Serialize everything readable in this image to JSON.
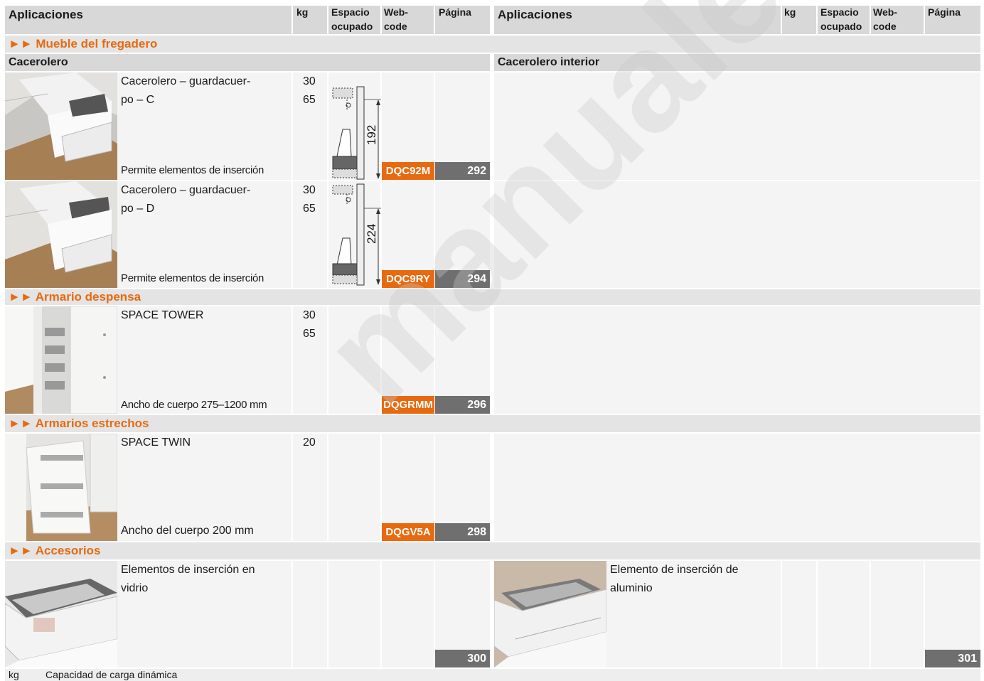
{
  "header": {
    "left": {
      "aplicaciones": "Aplicaciones",
      "kg": "kg",
      "espacio1": "Espacio",
      "espacio2": "ocupado",
      "web1": "Web-",
      "web2": "code",
      "pagina": "Página"
    },
    "right": {
      "aplicaciones": "Aplicaciones",
      "kg": "kg",
      "espacio1": "Espacio",
      "espacio2": "ocupado",
      "web1": "Web-",
      "web2": "code",
      "pagina": "Página"
    }
  },
  "sections": {
    "fregadero": "►► Mueble del fregadero",
    "despensa": "►► Armario despensa",
    "estrechos": "►► Armarios estrechos",
    "accesorios": "►► Accesorios"
  },
  "subheaders": {
    "left": "Cacerolero",
    "right": "Cacerolero interior"
  },
  "products": [
    {
      "name1": "Cacerolero – guardacuer-",
      "name2": "po – C",
      "note": "Permite elementos de inserción",
      "kg1": "30",
      "kg2": "65",
      "dimension": "192",
      "webcode": "DQC92M",
      "page": "292"
    },
    {
      "name1": "Cacerolero – guardacuer-",
      "name2": "po – D",
      "note": "Permite elementos de inserción",
      "kg1": "30",
      "kg2": "65",
      "dimension": "224",
      "webcode": "DQC9RY",
      "page": "294"
    },
    {
      "name1": "SPACE TOWER",
      "note": "Ancho de cuerpo 275–1200 mm",
      "kg1": "30",
      "kg2": "65",
      "webcode": "DQGRMM",
      "page": "296"
    },
    {
      "name1": "SPACE TWIN",
      "note": "Ancho del cuerpo 200 mm",
      "kg1": "20",
      "webcode": "DQGV5A",
      "page": "298"
    }
  ],
  "accessories": {
    "left": {
      "name1": "Elementos de inserción en",
      "name2": "vidrio",
      "page": "300"
    },
    "right": {
      "name1": "Elemento de inserción de",
      "name2": "aluminio",
      "page": "301"
    }
  },
  "footer": {
    "abbr": "kg",
    "text": "Capacidad de carga dinámica"
  },
  "watermark": "manualengual.com",
  "colors": {
    "accent": "#e86a10",
    "page_badge": "#6f6f6f",
    "header_bg": "#d8d8d8",
    "row_bg": "#f4f4f4"
  }
}
